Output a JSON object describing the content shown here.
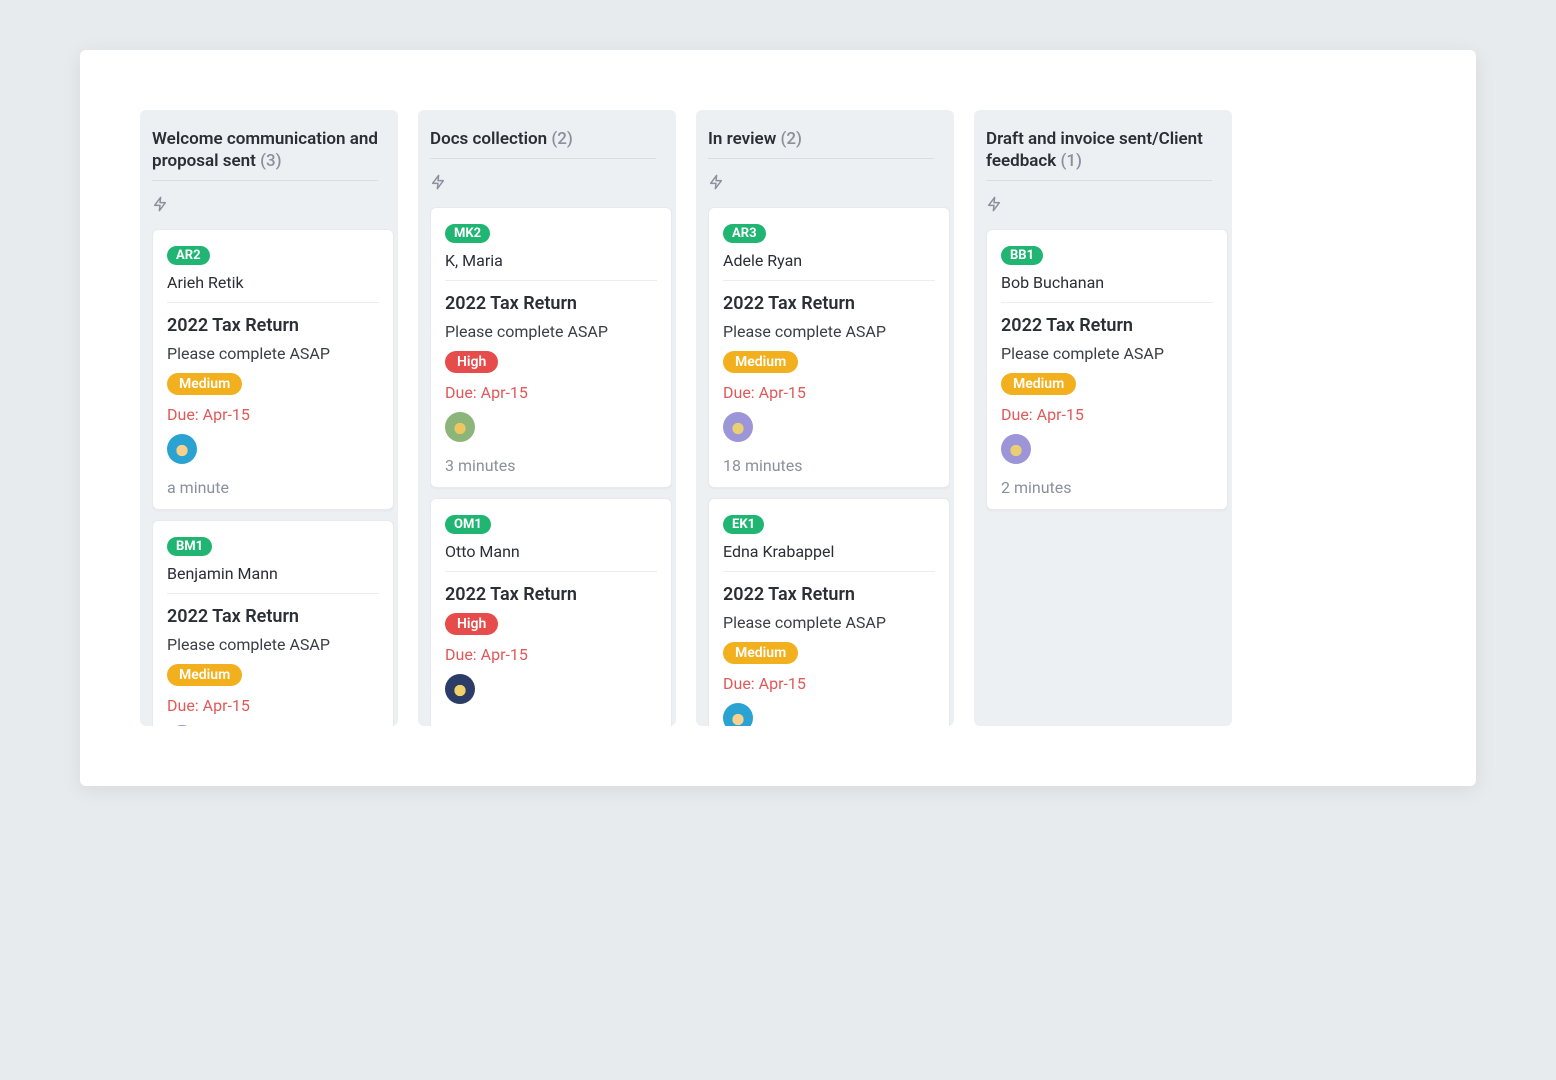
{
  "columns": [
    {
      "title": "Welcome communication and proposal sent",
      "count": "(3)",
      "scroll": true,
      "cards": [
        {
          "tag": "AR2",
          "client": "Arieh Retik",
          "task": "2022 Tax Return",
          "desc": "Please complete ASAP",
          "priority": "Medium",
          "priorityClass": "priority-medium",
          "due": "Due: Apr-15",
          "avatarClass": "blue",
          "elapsed": "a minute"
        },
        {
          "tag": "BM1",
          "client": "Benjamin Mann",
          "task": "2022 Tax Return",
          "desc": "Please complete ASAP",
          "priority": "Medium",
          "priorityClass": "priority-medium",
          "due": "Due: Apr-15",
          "avatarClass": "purple",
          "elapsed": ""
        }
      ]
    },
    {
      "title": "Docs collection",
      "count": "(2)",
      "scroll": true,
      "cards": [
        {
          "tag": "MK2",
          "client": "K, Maria",
          "task": "2022 Tax Return",
          "desc": "Please complete ASAP",
          "priority": "High",
          "priorityClass": "priority-high",
          "due": "Due: Apr-15",
          "avatarClass": "green",
          "elapsed": "3 minutes"
        },
        {
          "tag": "OM1",
          "client": "Otto Mann",
          "task": "2022 Tax Return",
          "desc": "",
          "priority": "High",
          "priorityClass": "priority-high",
          "due": "Due: Apr-15",
          "avatarClass": "orange",
          "elapsed": ""
        }
      ]
    },
    {
      "title": "In review",
      "count": "(2)",
      "scroll": true,
      "cards": [
        {
          "tag": "AR3",
          "client": "Adele Ryan",
          "task": "2022 Tax Return",
          "desc": "Please complete ASAP",
          "priority": "Medium",
          "priorityClass": "priority-medium",
          "due": "Due: Apr-15",
          "avatarClass": "purple",
          "elapsed": "18 minutes"
        },
        {
          "tag": "EK1",
          "client": "Edna Krabappel",
          "task": "2022 Tax Return",
          "desc": "Please complete ASAP",
          "priority": "Medium",
          "priorityClass": "priority-medium",
          "due": "Due: Apr-15",
          "avatarClass": "blue",
          "elapsed": ""
        }
      ]
    },
    {
      "title": "Draft and invoice sent/Client feedback",
      "count": "(1)",
      "scroll": false,
      "cards": [
        {
          "tag": "BB1",
          "client": "Bob Buchanan",
          "task": "2022 Tax Return",
          "desc": "Please complete ASAP",
          "priority": "Medium",
          "priorityClass": "priority-medium",
          "due": "Due: Apr-15",
          "avatarClass": "purple",
          "elapsed": "2 minutes"
        }
      ]
    }
  ]
}
